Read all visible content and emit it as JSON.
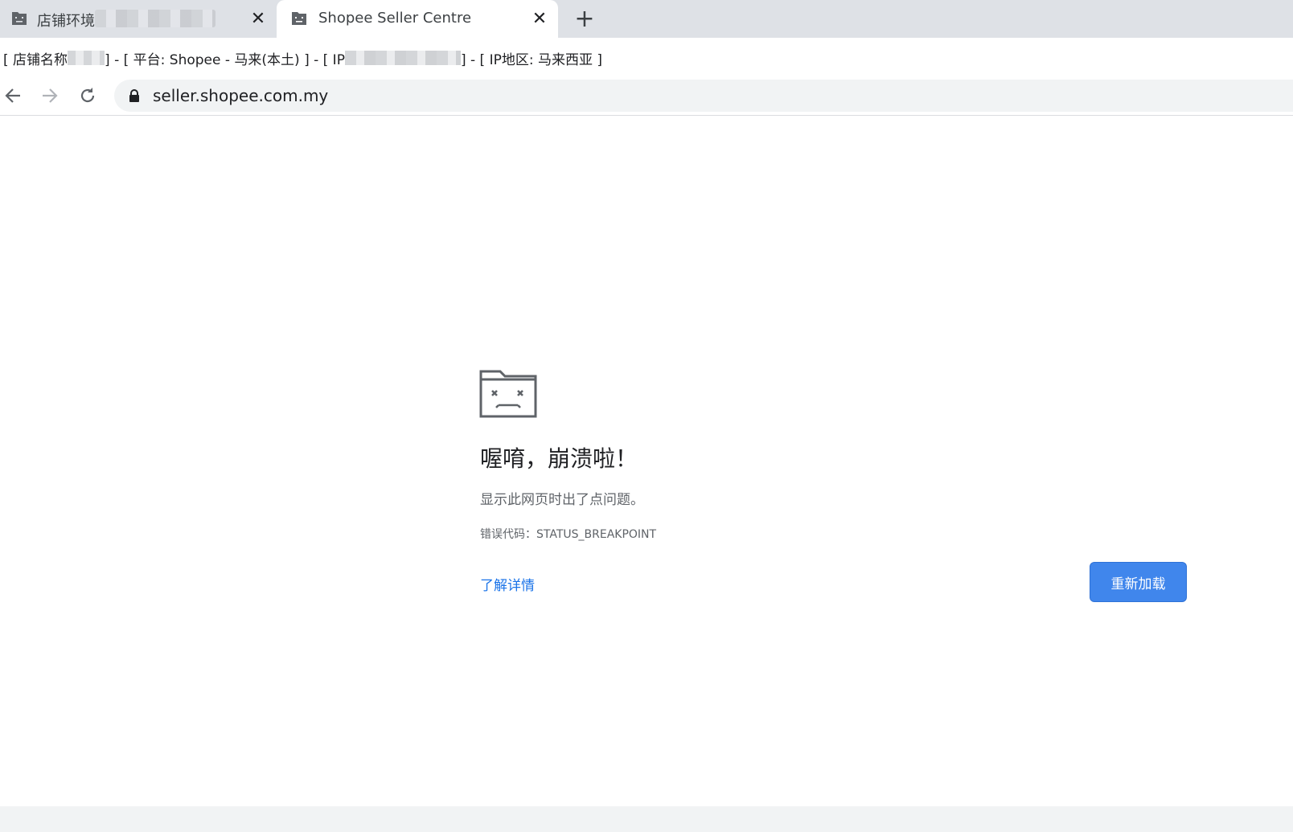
{
  "tabs": [
    {
      "title": "店铺环境",
      "icon": "folder-sad-icon",
      "close_label": "✕",
      "active": false
    },
    {
      "title": "Shopee Seller Centre",
      "icon": "folder-sad-icon",
      "close_label": "✕",
      "active": true
    }
  ],
  "new_tab_label": "+",
  "info_bar": {
    "part1": "[ 店铺名称",
    "part2": "] - [ 平台: Shopee - 马来(本土) ] - [ IP",
    "part3": "] - [ IP地区: 马来西亚 ]"
  },
  "toolbar": {
    "back_icon": "arrow-left-icon",
    "forward_icon": "arrow-right-icon",
    "reload_icon": "reload-icon",
    "url": "seller.shopee.com.my"
  },
  "error": {
    "heading": "喔唷，崩溃啦！",
    "message": "显示此网页时出了点问题。",
    "code_text": "错误代码：STATUS_BREAKPOINT",
    "learn_more": "了解详情",
    "reload_button": "重新加载"
  },
  "colors": {
    "tabstrip_bg": "#dee1e6",
    "omnibox_bg": "#f1f3f4",
    "link": "#1a73e8",
    "button": "#4086ec"
  }
}
